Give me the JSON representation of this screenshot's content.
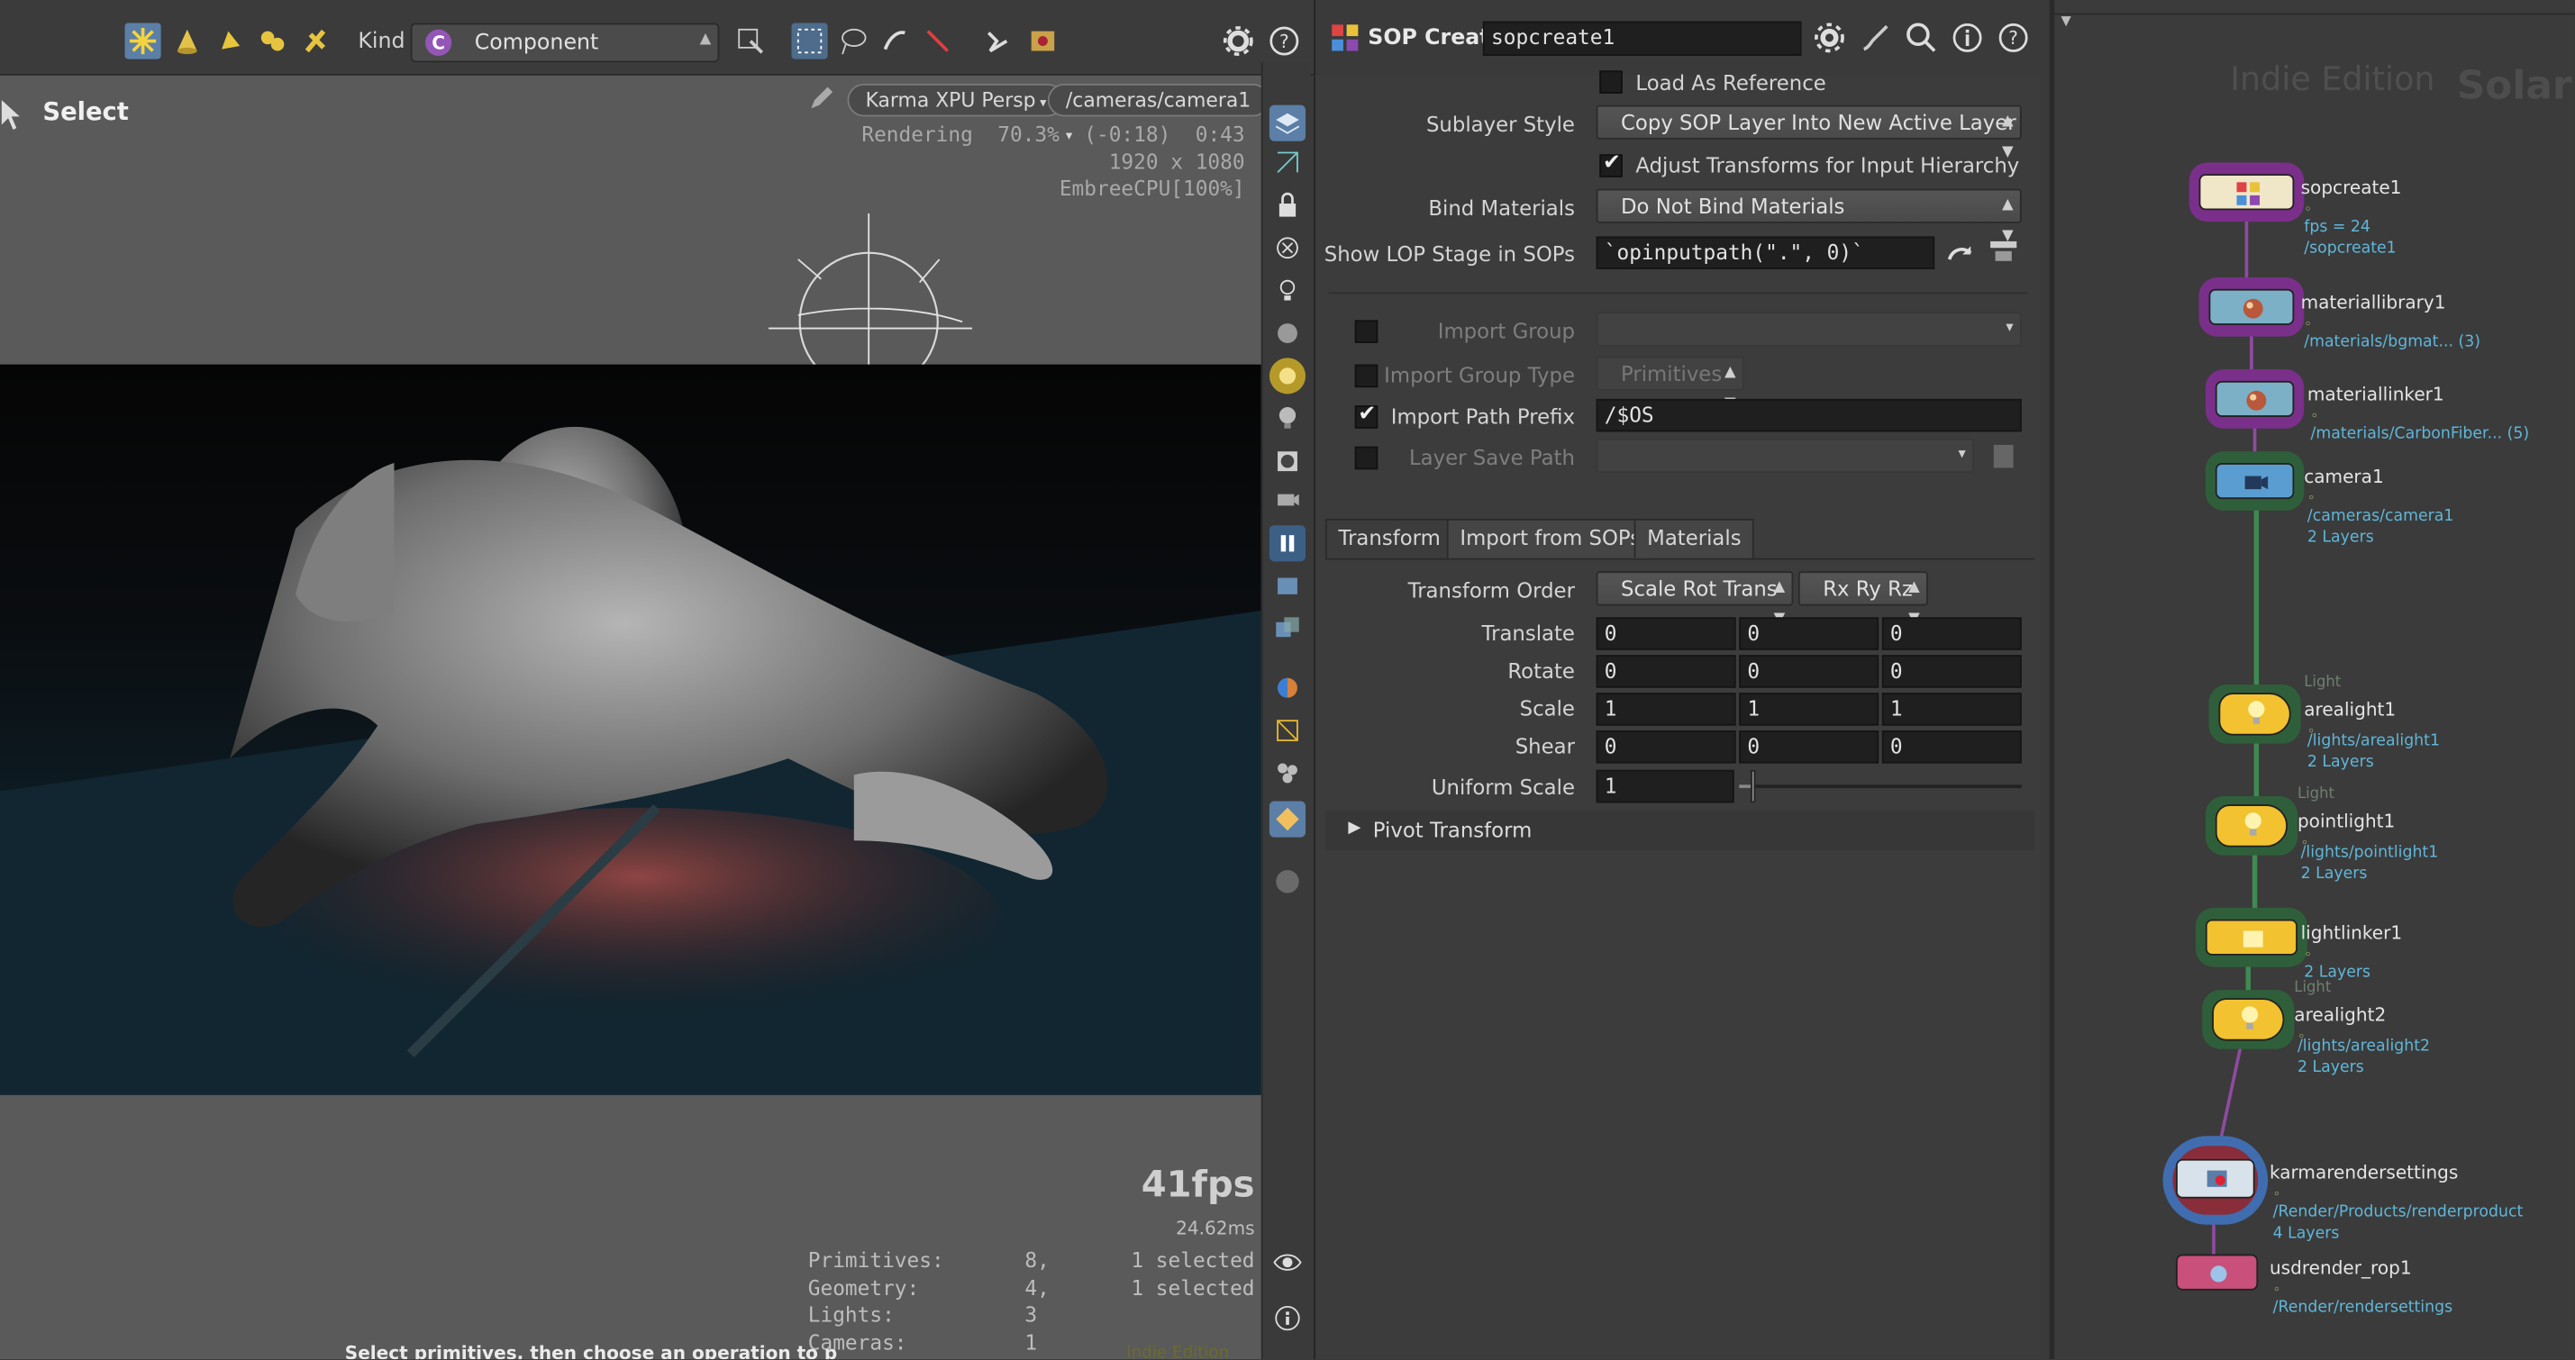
{
  "toolbar": {
    "kind_label": "Kind",
    "kind_badge": "C",
    "kind_value": "Component"
  },
  "viewport": {
    "select_label": "Select",
    "renderer": "Karma XPU",
    "view": "Persp",
    "camera": "/cameras/camera1",
    "render_status": "Rendering  70.3%  (-0:18)  0:43",
    "resolution": "1920 x 1080",
    "device": "EmbreeCPU[100%]",
    "fps": "41fps",
    "frame_ms": "24.62ms",
    "stats": [
      {
        "label": "Primitives:",
        "count": "8,",
        "sel": "1 selected"
      },
      {
        "label": "Geometry:",
        "count": "4,",
        "sel": "1 selected"
      },
      {
        "label": "Lights:",
        "count": "3",
        "sel": ""
      },
      {
        "label": "Cameras:",
        "count": "1",
        "sel": ""
      }
    ],
    "status_hint": "Select primitives, then choose an operation to p",
    "watermark": "Indie Edition"
  },
  "params": {
    "node_type": "SOP Create",
    "node_name": "sopcreate1",
    "load_as_reference": "Load As Reference",
    "sublayer_style_label": "Sublayer Style",
    "sublayer_style_value": "Copy SOP Layer Into New Active Layer",
    "adjust_transforms": "Adjust Transforms for Input Hierarchy",
    "bind_materials_label": "Bind Materials",
    "bind_materials_value": "Do Not Bind Materials",
    "show_lop_label": "Show LOP Stage in SOPs",
    "show_lop_value": "`opinputpath(\".\", 0)`",
    "import_group_label": "Import Group",
    "import_group_type_label": "Import Group Type",
    "import_group_type_value": "Primitives",
    "import_path_prefix_label": "Import Path Prefix",
    "import_path_prefix_value": "/$OS",
    "layer_save_path_label": "Layer Save Path",
    "tabs": [
      "Transform",
      "Import from SOPs",
      "Materials"
    ],
    "transform_order_label": "Transform Order",
    "transform_order_value": "Scale Rot Trans",
    "rotate_order_value": "Rx Ry Rz",
    "rows": [
      {
        "label": "Translate",
        "v": [
          "0",
          "0",
          "0"
        ]
      },
      {
        "label": "Rotate",
        "v": [
          "0",
          "0",
          "0"
        ]
      },
      {
        "label": "Scale",
        "v": [
          "1",
          "1",
          "1"
        ]
      },
      {
        "label": "Shear",
        "v": [
          "0",
          "0",
          "0"
        ]
      }
    ],
    "uniform_scale_label": "Uniform Scale",
    "uniform_scale_value": "1",
    "uniform_scale_fraction": 0.05,
    "pivot_transform": "Pivot Transform"
  },
  "network": {
    "watermark_1": "Indie Edition",
    "watermark_2": "Solari",
    "nodes": [
      {
        "name": "sopcreate1",
        "subs": [
          "fps = 24",
          "/sopcreate1"
        ],
        "tag": ""
      },
      {
        "name": "materiallibrary1",
        "subs": [
          "/materials/bgmat... (3)"
        ],
        "tag": ""
      },
      {
        "name": "materiallinker1",
        "subs": [
          "/materials/CarbonFiber... (5)"
        ],
        "tag": ""
      },
      {
        "name": "camera1",
        "subs": [
          "/cameras/camera1",
          "2 Layers"
        ],
        "tag": ""
      },
      {
        "name": "arealight1",
        "subs": [
          "/lights/arealight1",
          "2 Layers"
        ],
        "tag": "Light"
      },
      {
        "name": "pointlight1",
        "subs": [
          "/lights/pointlight1",
          "2 Layers"
        ],
        "tag": "Light"
      },
      {
        "name": "lightlinker1",
        "subs": [
          "2 Layers"
        ],
        "tag": ""
      },
      {
        "name": "arealight2",
        "subs": [
          "/lights/arealight2",
          "2 Layers"
        ],
        "tag": "Light"
      },
      {
        "name": "karmarendersettings",
        "subs": [
          "/Render/Products/renderproduct",
          "4 Layers"
        ],
        "tag": ""
      },
      {
        "name": "usdrender_rop1",
        "subs": [
          "/Render/rendersettings"
        ],
        "tag": ""
      }
    ]
  },
  "colors": {
    "accent_blue": "#5b7fa6",
    "node_path": "#5fb6d9",
    "halo_purple": "#7a2f8a",
    "halo_green": "#2f5f3a",
    "light_yellow": "#f2c230"
  }
}
